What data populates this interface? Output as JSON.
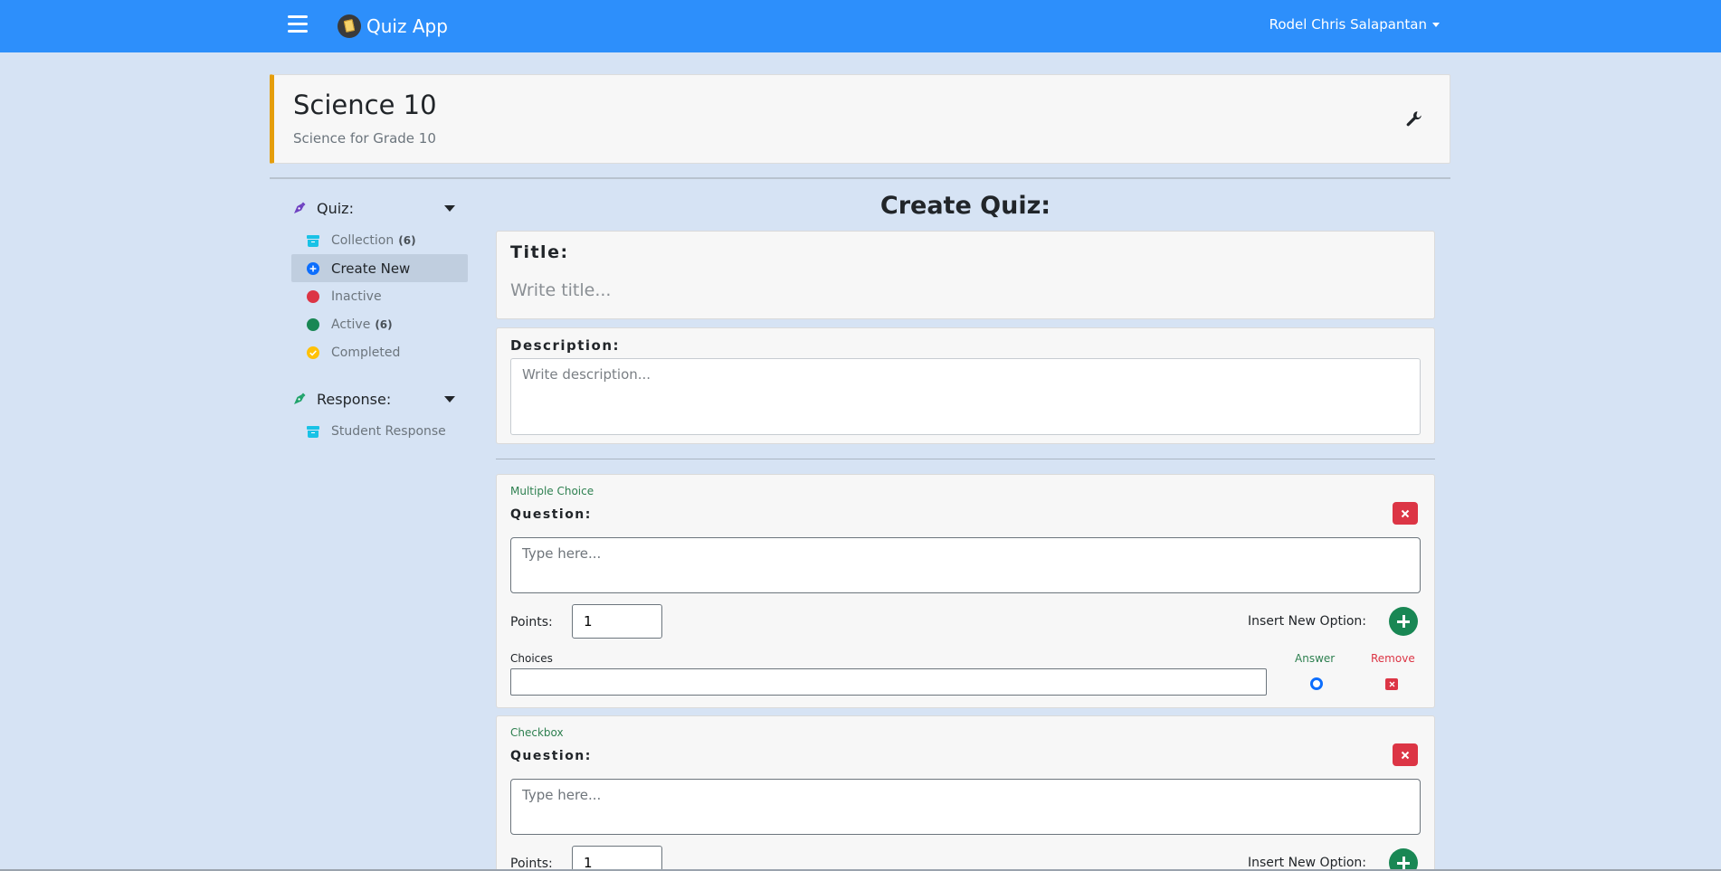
{
  "navbar": {
    "brand": "Quiz App",
    "user_name": "Rodel Chris Salapantan"
  },
  "course": {
    "title": "Science 10",
    "subtitle": "Science for Grade 10"
  },
  "sidebar": {
    "quiz_section": {
      "label": "Quiz:",
      "items": [
        {
          "label": "Collection",
          "count": "(6)",
          "icon": "archive-icon",
          "color": "#19c2e6"
        },
        {
          "label": "Create New",
          "count": "",
          "icon": "plus-circle-icon",
          "color": "#0d6efd",
          "active": true
        },
        {
          "label": "Inactive",
          "count": "",
          "icon": "red-dot-icon",
          "color": "#dc3545"
        },
        {
          "label": "Active",
          "count": "(6)",
          "icon": "green-dot-icon",
          "color": "#198754"
        },
        {
          "label": "Completed",
          "count": "",
          "icon": "check-circle-icon",
          "color": "#ffc107"
        }
      ]
    },
    "response_section": {
      "label": "Response:",
      "items": [
        {
          "label": "Student Response",
          "count": "",
          "icon": "archive-icon",
          "color": "#19c2e6"
        }
      ]
    }
  },
  "main": {
    "heading": "Create Quiz:",
    "title_field": {
      "label": "Title:",
      "placeholder": "Write title..."
    },
    "description_field": {
      "label": "Description:",
      "placeholder": "Write description..."
    },
    "questions": [
      {
        "type": "Multiple Choice",
        "label": "Question:",
        "placeholder": "Type here...",
        "points_label": "Points:",
        "points_value": "1",
        "insert_option_label": "Insert New Option:",
        "choices_label": "Choices",
        "answer_label": "Answer",
        "remove_label": "Remove"
      },
      {
        "type": "Checkbox",
        "label": "Question:",
        "placeholder": "Type here...",
        "points_label": "Points:",
        "points_value": "1",
        "insert_option_label": "Insert New Option:"
      }
    ]
  },
  "colors": {
    "navbar": "#2d8ffb",
    "page_background": "#d6e3f4",
    "course_accent": "#e59e0c",
    "danger": "#dc3545",
    "success": "#198754"
  }
}
